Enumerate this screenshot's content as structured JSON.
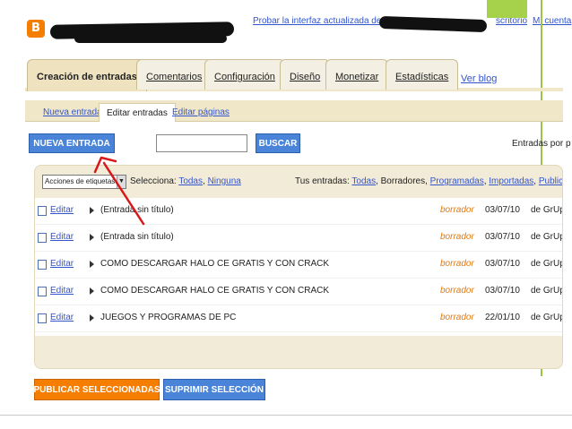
{
  "header": {
    "try_new_interface": "Probar la interfaz actualizada de Blogger",
    "dashboard_link": "scritorio",
    "account_link": "Mi cuenta"
  },
  "tabs": [
    {
      "label": "Creación de entradas",
      "active": true
    },
    {
      "label": "Comentarios",
      "active": false
    },
    {
      "label": "Configuración",
      "active": false
    },
    {
      "label": "Diseño",
      "active": false
    },
    {
      "label": "Monetizar",
      "active": false
    },
    {
      "label": "Estadísticas",
      "active": false
    }
  ],
  "view_blog": "Ver blog",
  "subtabs": [
    {
      "label": "Nueva entrada",
      "active": false
    },
    {
      "label": "Editar entradas",
      "active": true
    },
    {
      "label": "Editar páginas",
      "active": false
    }
  ],
  "actions": {
    "new_post_button": "NUEVA ENTRADA",
    "search_button": "BUSCAR",
    "search_value": "",
    "entries_per_page": "Entradas por p"
  },
  "filters": {
    "label_actions": "Acciones de etiquetas...",
    "select_prefix": "Selecciona:",
    "select_all": "Todas",
    "select_none": "Ninguna",
    "your_posts_prefix": "Tus entradas:",
    "all": "Todas",
    "drafts": "Borradores",
    "scheduled": "Programadas",
    "imported": "Importadas",
    "published": "Publicadas"
  },
  "posts": [
    {
      "edit": "Editar",
      "title": "(Entrada sin título)",
      "status": "borrador",
      "date": "03/07/10",
      "author": "de GrUpC"
    },
    {
      "edit": "Editar",
      "title": "(Entrada sin título)",
      "status": "borrador",
      "date": "03/07/10",
      "author": "de GrUpC"
    },
    {
      "edit": "Editar",
      "title": "COMO DESCARGAR HALO CE GRATIS Y CON CRACK",
      "status": "borrador",
      "date": "03/07/10",
      "author": "de GrUpC"
    },
    {
      "edit": "Editar",
      "title": "COMO DESCARGAR HALO CE GRATIS Y CON CRACK",
      "status": "borrador",
      "date": "03/07/10",
      "author": "de GrUpC"
    },
    {
      "edit": "Editar",
      "title": "JUEGOS Y PROGRAMAS DE PC",
      "status": "borrador",
      "date": "22/01/10",
      "author": "de GrUpC"
    }
  ],
  "bottom_actions": {
    "publish_selected": "PUBLICAR SELECCIONADAS",
    "delete_selected": "SUPRIMIR SELECCIÓN"
  },
  "colors": {
    "accent_blue": "#4a84d8",
    "accent_orange": "#f57d00",
    "tab_bg": "#efe3bf",
    "annotation_red": "#d81818"
  }
}
